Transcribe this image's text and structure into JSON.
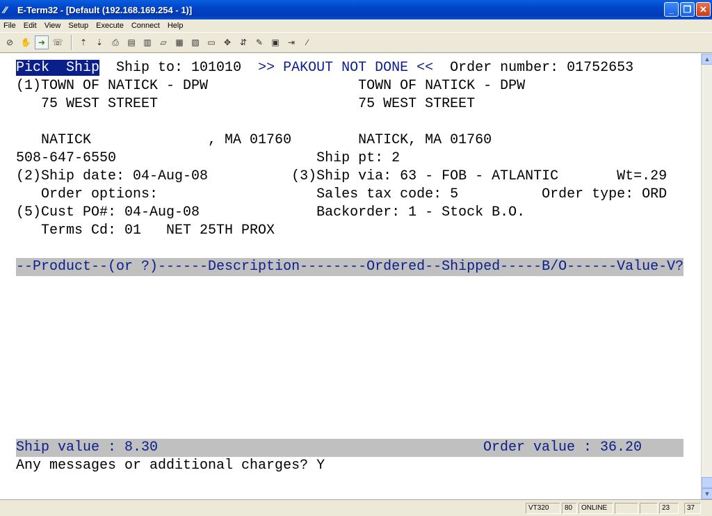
{
  "window": {
    "title": "E-Term32 - [Default (192.168.169.254 - 1)]",
    "minimize": "_",
    "restore": "❐",
    "close": "✕"
  },
  "menu": [
    "File",
    "Edit",
    "View",
    "Setup",
    "Execute",
    "Connect",
    "Help"
  ],
  "terminal": {
    "header_tab": "Pick  Ship",
    "ship_to": "  Ship to: 101010  ",
    "pakout": ">> PAKOUT NOT DONE <<",
    "order_number": "  Order number: 01752653",
    "line2": "(1)TOWN OF NATICK - DPW                  TOWN OF NATICK - DPW",
    "line3": "   75 WEST STREET                        75 WEST STREET",
    "line5": "   NATICK              , MA 01760        NATICK, MA 01760",
    "line6": "508-647-6550                        Ship pt: 2",
    "line7": "(2)Ship date: 04-Aug-08          (3)Ship via: 63 - FOB - ATLANTIC       Wt=.29",
    "line8": "   Order options:                   Sales tax code: 5          Order type: ORD",
    "line9": "(5)Cust PO#: 04-Aug-08              Backorder: 1 - Stock B.O.",
    "line10": "   Terms Cd: 01   NET 25TH PROX",
    "columns_header": "--Product--(or ?)------Description--------Ordered--Shipped-----B/O------Value-V?",
    "ship_value": "Ship value : 8.30",
    "order_value": "Order value : 36.20",
    "prompt": "Any messages or additional charges? Y"
  },
  "status": {
    "term_type": "VT320",
    "columns": "80",
    "connection": "ONLINE",
    "row": "23",
    "col": "37"
  }
}
